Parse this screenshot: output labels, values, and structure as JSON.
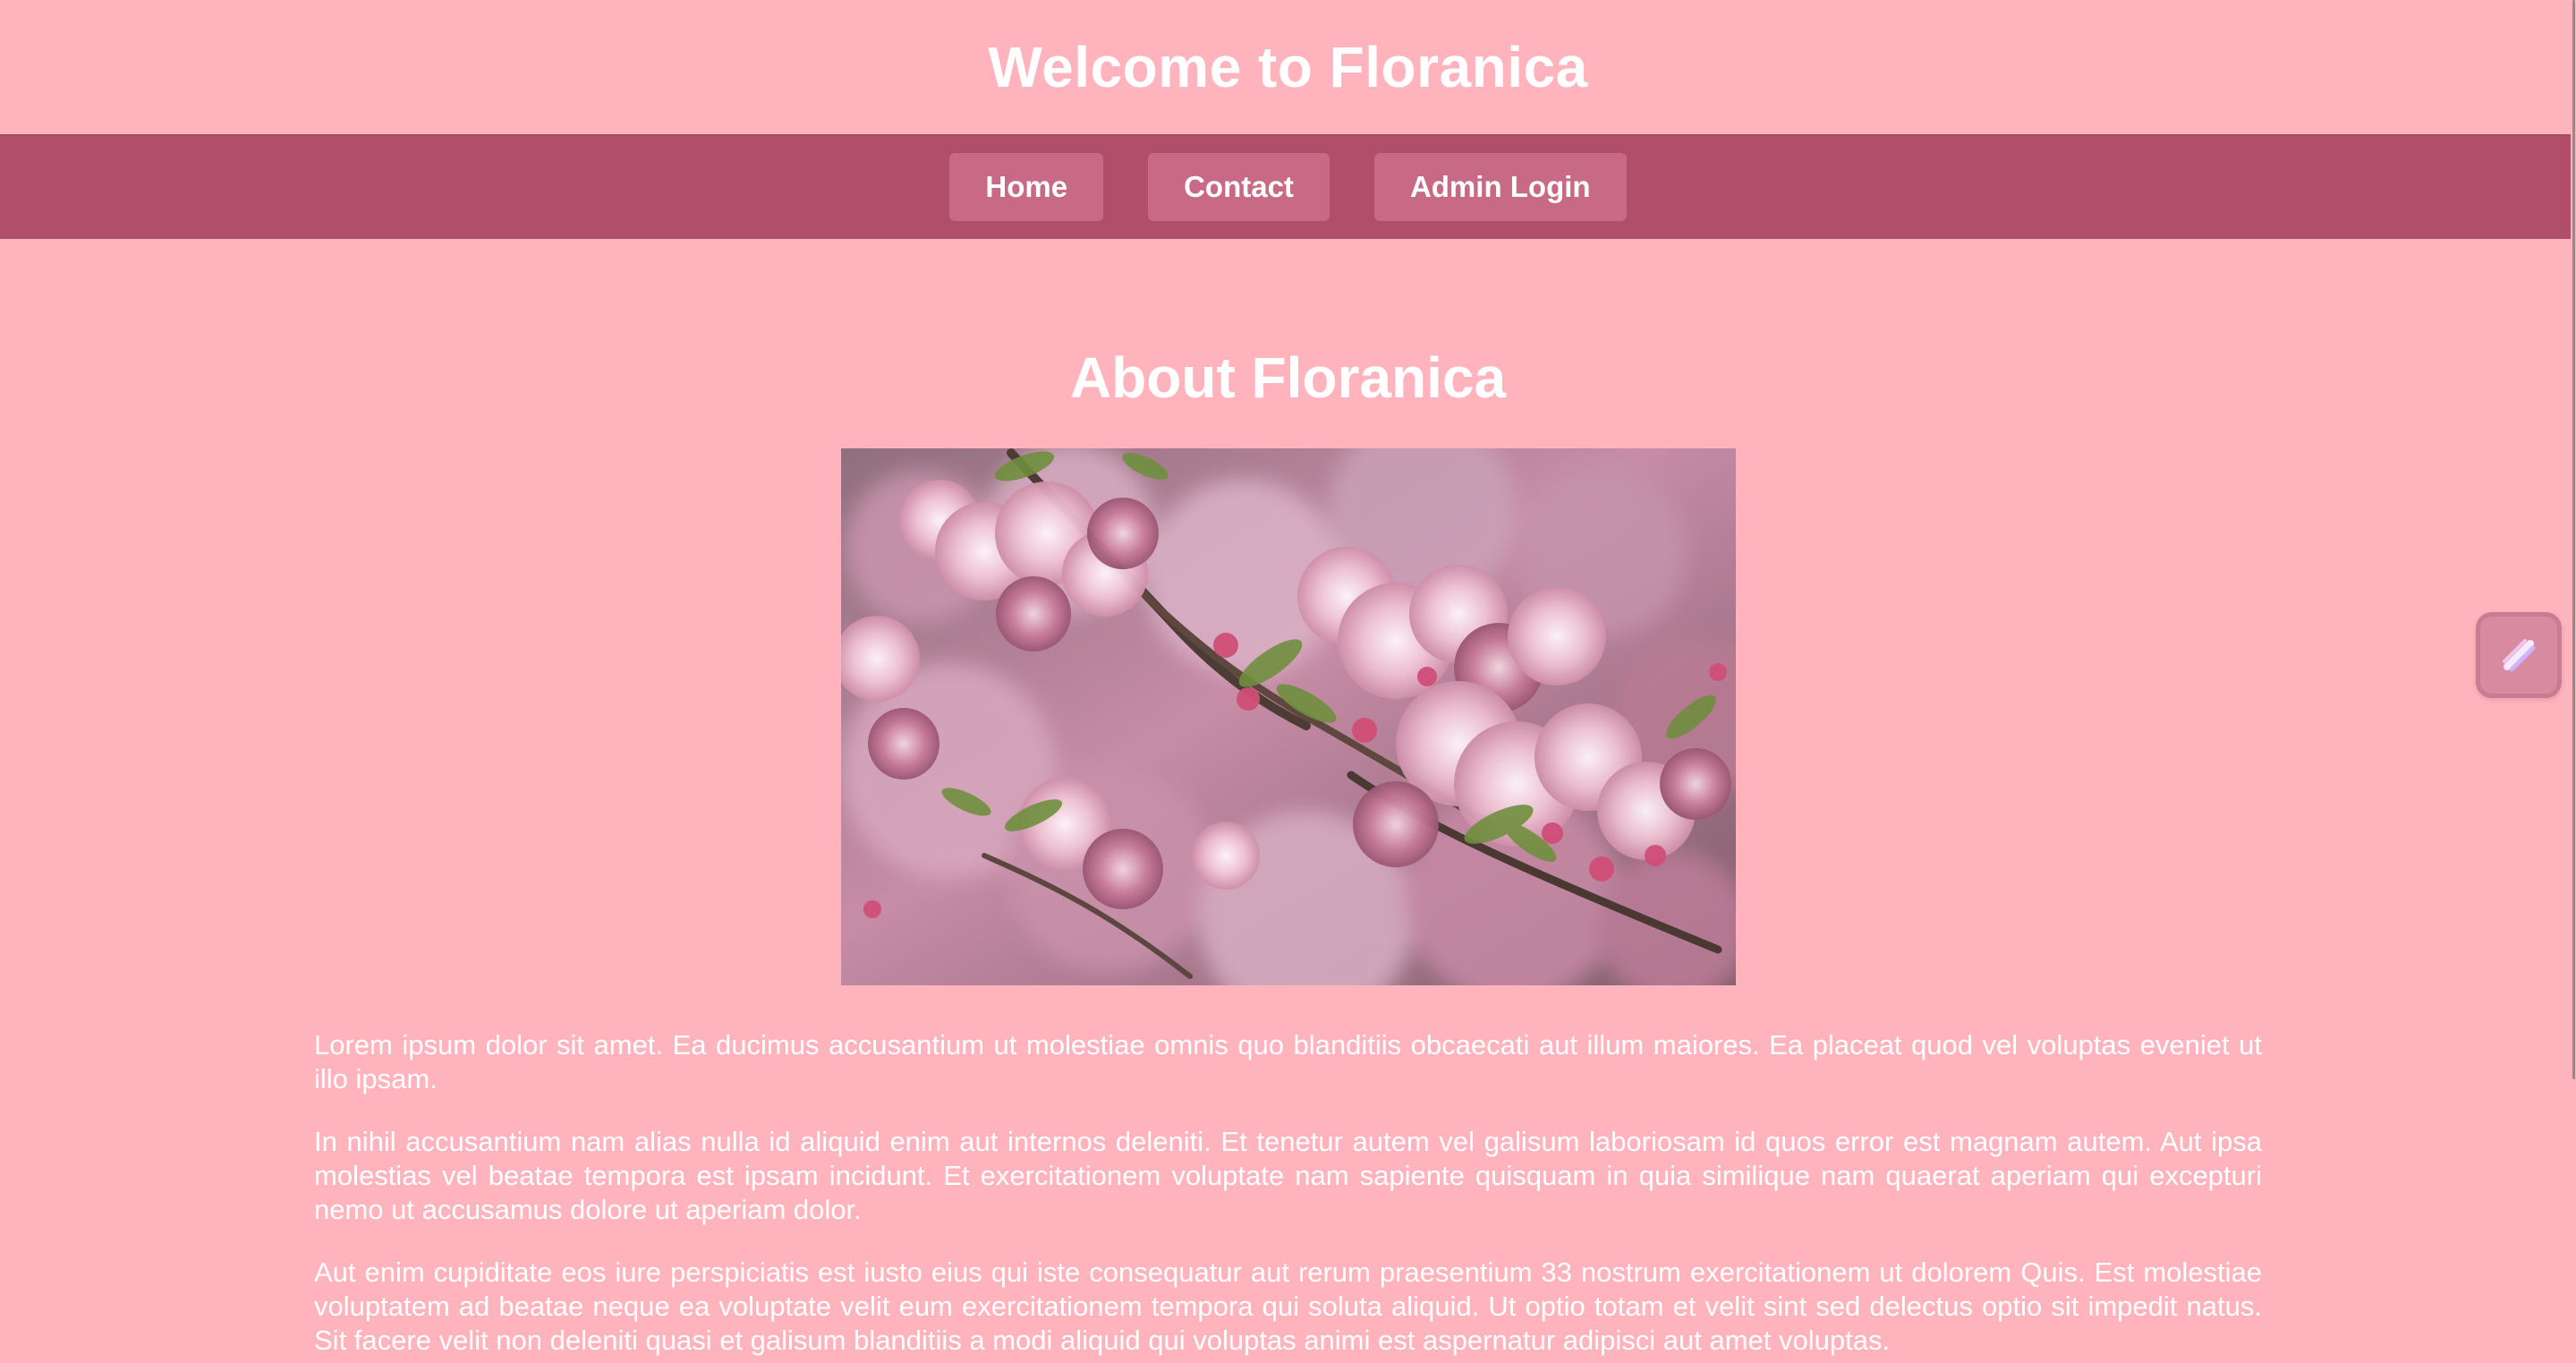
{
  "header": {
    "title": "Welcome to Floranica"
  },
  "nav": {
    "items": [
      {
        "label": "Home"
      },
      {
        "label": "Contact"
      },
      {
        "label": "Admin Login"
      }
    ]
  },
  "about": {
    "title": "About Floranica",
    "image_alt": "Pink cherry blossom branches",
    "paragraphs": [
      "Lorem ipsum dolor sit amet. Ea ducimus accusantium ut molestiae omnis quo blanditiis obcaecati aut illum maiores. Ea placeat quod vel voluptas eveniet ut illo ipsam.",
      "In nihil accusantium nam alias nulla id aliquid enim aut internos deleniti. Et tenetur autem vel galisum laboriosam id quos error est magnam autem. Aut ipsa molestias vel beatae tempora est ipsam incidunt. Et exercitationem voluptate nam sapiente quisquam in quia similique nam quaerat aperiam qui excepturi nemo ut accusamus dolore ut aperiam dolor.",
      "Aut enim cupiditate eos iure perspiciatis est iusto eius qui iste consequatur aut rerum praesentium 33 nostrum exercitationem ut dolorem Quis. Est molestiae voluptatem ad beatae neque ea voluptate velit eum exercitationem tempora qui soluta aliquid. Ut optio totam et velit sint sed delectus optio sit impedit natus. Sit facere velit non deleniti quasi et galisum blanditiis a modi aliquid qui voluptas animi est aspernatur adipisci aut amet voluptas."
    ]
  },
  "widget": {
    "icon": "slash-icon"
  },
  "colors": {
    "background": "#ffb3bd",
    "nav_bar": "#b14f6a",
    "nav_button": "#c86a86",
    "text": "#ffffff"
  }
}
